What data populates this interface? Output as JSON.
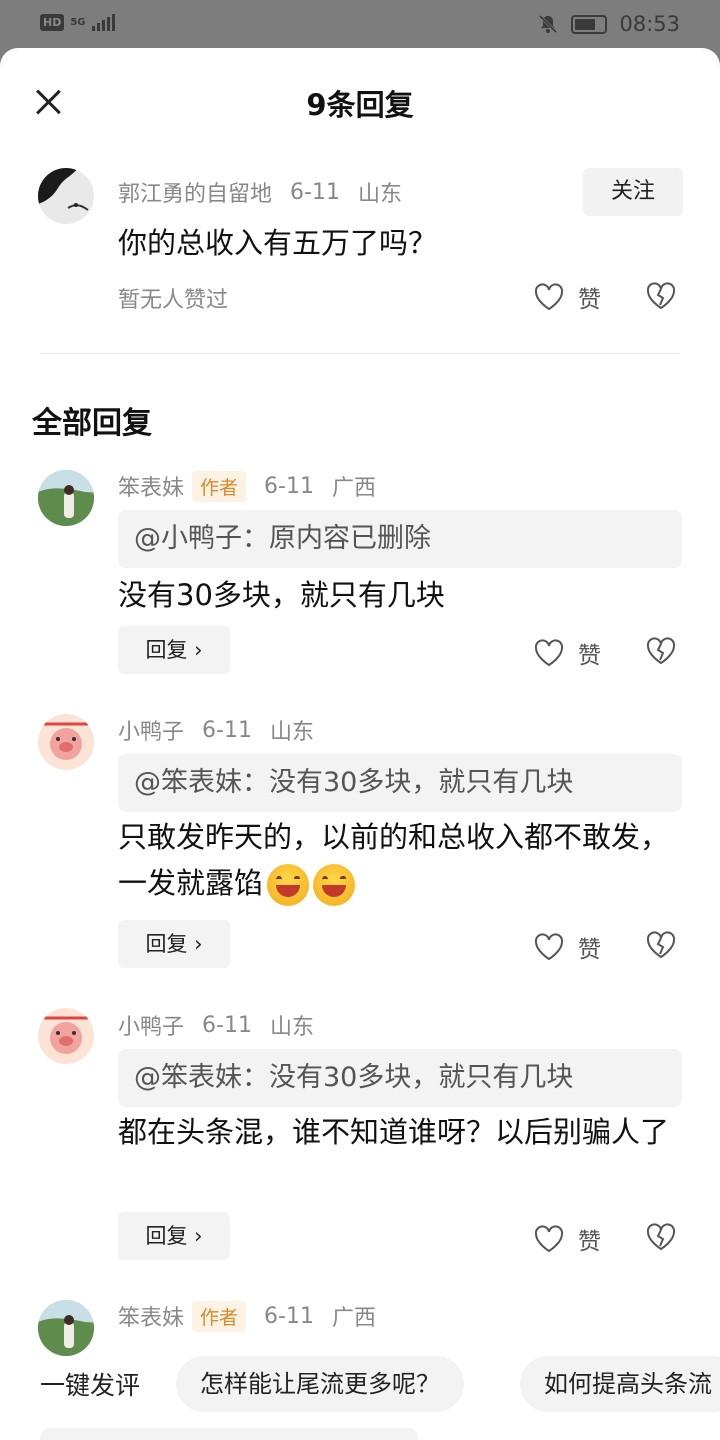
{
  "status_bar": {
    "network": "5G",
    "hd": "HD",
    "time": "08:53"
  },
  "sheet": {
    "title": "9条回复"
  },
  "original": {
    "username": "郭江勇的自留地",
    "date": "6-11",
    "location": "山东",
    "follow_label": "关注",
    "text": "你的总收入有五万了吗？",
    "no_likes": "暂无人赞过",
    "like_label": "赞"
  },
  "section_title": "全部回复",
  "replies": [
    {
      "username": "笨表妹",
      "author_tag": "作者",
      "date": "6-11",
      "location": "广西",
      "quote": "@小鸭子：原内容已删除",
      "text": "没有30多块，就只有几块",
      "reply_label": "回复 ›",
      "like_label": "赞"
    },
    {
      "username": "小鸭子",
      "date": "6-11",
      "location": "山东",
      "quote": "@笨表妹：没有30多块，就只有几块",
      "text": "只敢发昨天的，以前的和总收入都不敢发，一发就露馅",
      "reply_label": "回复 ›",
      "like_label": "赞"
    },
    {
      "username": "小鸭子",
      "date": "6-11",
      "location": "山东",
      "quote": "@笨表妹：没有30多块，就只有几块",
      "text": "都在头条混，谁不知道谁呀？以后别骗人了",
      "reply_label": "回复 ›",
      "like_label": "赞"
    },
    {
      "username": "笨表妹",
      "author_tag": "作者",
      "date": "6-11",
      "location": "广西"
    }
  ],
  "bottom_bar": {
    "label": "一键发评",
    "suggestions": [
      "怎样能让尾流更多呢？",
      "如何提高头条流"
    ]
  }
}
